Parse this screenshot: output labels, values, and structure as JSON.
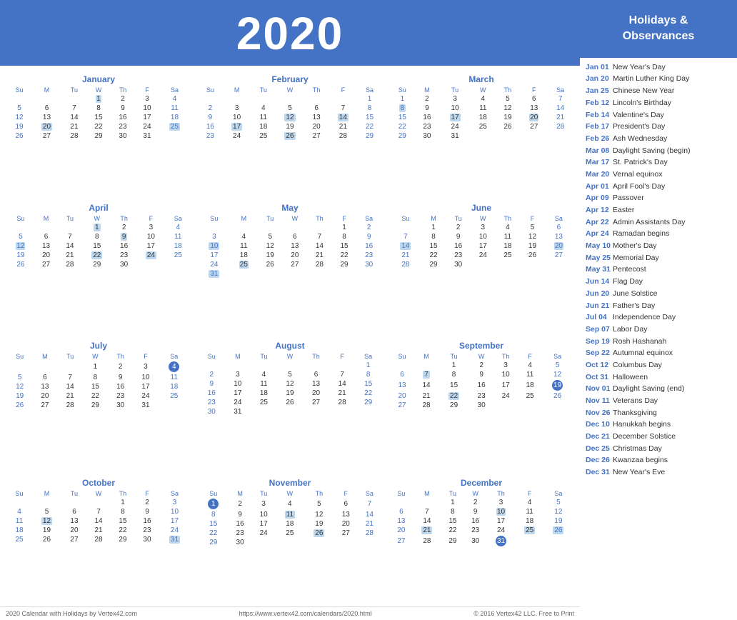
{
  "title": "2020",
  "header": {
    "holidays_title": "Holidays &\nObservances"
  },
  "months": [
    {
      "name": "January",
      "days": [
        [
          "",
          "",
          "",
          "1",
          "2",
          "3",
          "4"
        ],
        [
          "5",
          "6",
          "7",
          "8",
          "9",
          "10",
          "11"
        ],
        [
          "12",
          "13",
          "14",
          "15",
          "16",
          "17",
          "18"
        ],
        [
          "19",
          "20",
          "21",
          "22",
          "23",
          "24",
          "25"
        ],
        [
          "26",
          "27",
          "28",
          "29",
          "30",
          "31",
          ""
        ]
      ],
      "highlights": {
        "1": "holiday",
        "20": "highlight",
        "25": "highlight"
      }
    },
    {
      "name": "February",
      "days": [
        [
          "",
          "",
          "",
          "",
          "",
          "",
          "1"
        ],
        [
          "2",
          "3",
          "4",
          "5",
          "6",
          "7",
          "8"
        ],
        [
          "9",
          "10",
          "11",
          "12",
          "13",
          "14",
          "15"
        ],
        [
          "16",
          "17",
          "18",
          "19",
          "20",
          "21",
          "22"
        ],
        [
          "23",
          "24",
          "25",
          "26",
          "27",
          "28",
          "29"
        ]
      ],
      "highlights": {
        "12": "highlight",
        "14": "highlight",
        "17": "highlight",
        "26": "highlight"
      }
    },
    {
      "name": "March",
      "days": [
        [
          "1",
          "2",
          "3",
          "4",
          "5",
          "6",
          "7"
        ],
        [
          "8",
          "9",
          "10",
          "11",
          "12",
          "13",
          "14"
        ],
        [
          "15",
          "16",
          "17",
          "18",
          "19",
          "20",
          "21"
        ],
        [
          "22",
          "23",
          "24",
          "25",
          "26",
          "27",
          "28"
        ],
        [
          "29",
          "30",
          "31",
          "",
          "",
          "",
          ""
        ]
      ],
      "highlights": {
        "8": "highlight",
        "17": "highlight",
        "20": "holiday"
      }
    },
    {
      "name": "April",
      "days": [
        [
          "",
          "",
          "",
          "1",
          "2",
          "3",
          "4"
        ],
        [
          "5",
          "6",
          "7",
          "8",
          "9",
          "10",
          "11"
        ],
        [
          "12",
          "13",
          "14",
          "15",
          "16",
          "17",
          "18"
        ],
        [
          "19",
          "20",
          "21",
          "22",
          "23",
          "24",
          "25"
        ],
        [
          "26",
          "27",
          "28",
          "29",
          "30",
          "",
          ""
        ]
      ],
      "highlights": {
        "1": "highlight",
        "9": "highlight",
        "12": "holiday",
        "22": "highlight",
        "24": "highlight"
      }
    },
    {
      "name": "May",
      "days": [
        [
          "",
          "",
          "",
          "",
          "",
          "1",
          "2"
        ],
        [
          "3",
          "4",
          "5",
          "6",
          "7",
          "8",
          "9"
        ],
        [
          "10",
          "11",
          "12",
          "13",
          "14",
          "15",
          "16"
        ],
        [
          "17",
          "18",
          "19",
          "20",
          "21",
          "22",
          "23"
        ],
        [
          "24",
          "25",
          "26",
          "27",
          "28",
          "29",
          "30"
        ],
        [
          "31",
          "",
          "",
          "",
          "",
          "",
          ""
        ]
      ],
      "highlights": {
        "10": "highlight",
        "25": "holiday",
        "31": "highlight"
      }
    },
    {
      "name": "June",
      "days": [
        [
          "",
          "1",
          "2",
          "3",
          "4",
          "5",
          "6"
        ],
        [
          "7",
          "8",
          "9",
          "10",
          "11",
          "12",
          "13"
        ],
        [
          "14",
          "15",
          "16",
          "17",
          "18",
          "19",
          "20"
        ],
        [
          "21",
          "22",
          "23",
          "24",
          "25",
          "26",
          "27"
        ],
        [
          "28",
          "29",
          "30",
          "",
          "",
          "",
          ""
        ]
      ],
      "highlights": {
        "14": "highlight",
        "20": "holiday",
        "6": "saturday"
      }
    },
    {
      "name": "July",
      "days": [
        [
          "",
          "",
          "",
          "1",
          "2",
          "3",
          "4"
        ],
        [
          "5",
          "6",
          "7",
          "8",
          "9",
          "10",
          "11"
        ],
        [
          "12",
          "13",
          "14",
          "15",
          "16",
          "17",
          "18"
        ],
        [
          "19",
          "20",
          "21",
          "22",
          "23",
          "24",
          "25"
        ],
        [
          "26",
          "27",
          "28",
          "29",
          "30",
          "31",
          ""
        ]
      ],
      "highlights": {
        "4": "circle"
      }
    },
    {
      "name": "August",
      "days": [
        [
          "",
          "",
          "",
          "",
          "",
          "",
          "1"
        ],
        [
          "2",
          "3",
          "4",
          "5",
          "6",
          "7",
          "8"
        ],
        [
          "9",
          "10",
          "11",
          "12",
          "13",
          "14",
          "15"
        ],
        [
          "16",
          "17",
          "18",
          "19",
          "20",
          "21",
          "22"
        ],
        [
          "23",
          "24",
          "25",
          "26",
          "27",
          "28",
          "29"
        ],
        [
          "30",
          "31",
          "",
          "",
          "",
          "",
          ""
        ]
      ],
      "highlights": {}
    },
    {
      "name": "September",
      "days": [
        [
          "",
          "",
          "1",
          "2",
          "3",
          "4",
          "5"
        ],
        [
          "6",
          "7",
          "8",
          "9",
          "10",
          "11",
          "12"
        ],
        [
          "13",
          "14",
          "15",
          "16",
          "17",
          "18",
          "19"
        ],
        [
          "20",
          "21",
          "22",
          "23",
          "24",
          "25",
          "26"
        ],
        [
          "27",
          "28",
          "29",
          "30",
          "",
          "",
          ""
        ]
      ],
      "highlights": {
        "7": "highlight",
        "19": "circle",
        "22": "highlight"
      }
    },
    {
      "name": "October",
      "days": [
        [
          "",
          "",
          "",
          "",
          "1",
          "2",
          "3"
        ],
        [
          "4",
          "5",
          "6",
          "7",
          "8",
          "9",
          "10"
        ],
        [
          "11",
          "12",
          "13",
          "14",
          "15",
          "16",
          "17"
        ],
        [
          "18",
          "19",
          "20",
          "21",
          "22",
          "23",
          "24"
        ],
        [
          "25",
          "26",
          "27",
          "28",
          "29",
          "30",
          "31"
        ]
      ],
      "highlights": {
        "12": "highlight",
        "31": "highlight",
        "3": "saturday",
        "17": "saturday"
      }
    },
    {
      "name": "November",
      "days": [
        [
          "1",
          "2",
          "3",
          "4",
          "5",
          "6",
          "7"
        ],
        [
          "8",
          "9",
          "10",
          "11",
          "12",
          "13",
          "14"
        ],
        [
          "15",
          "16",
          "17",
          "18",
          "19",
          "20",
          "21"
        ],
        [
          "22",
          "23",
          "24",
          "25",
          "26",
          "27",
          "28"
        ],
        [
          "29",
          "30",
          "",
          "",
          "",
          "",
          ""
        ]
      ],
      "highlights": {
        "1": "circle",
        "11": "highlight",
        "26": "highlight"
      }
    },
    {
      "name": "December",
      "days": [
        [
          "",
          "",
          "1",
          "2",
          "3",
          "4",
          "5"
        ],
        [
          "6",
          "7",
          "8",
          "9",
          "10",
          "11",
          "12"
        ],
        [
          "13",
          "14",
          "15",
          "16",
          "17",
          "18",
          "19"
        ],
        [
          "20",
          "21",
          "22",
          "23",
          "24",
          "25",
          "26"
        ],
        [
          "27",
          "28",
          "29",
          "30",
          "31",
          "",
          ""
        ]
      ],
      "highlights": {
        "10": "holiday",
        "21": "highlight",
        "25": "highlight",
        "26": "highlight",
        "31": "circle"
      }
    }
  ],
  "holidays": [
    {
      "date": "Jan 01",
      "name": "New Year's Day"
    },
    {
      "date": "Jan 20",
      "name": "Martin Luther King Day"
    },
    {
      "date": "Jan 25",
      "name": "Chinese New Year"
    },
    {
      "date": "Feb 12",
      "name": "Lincoln's Birthday"
    },
    {
      "date": "Feb 14",
      "name": "Valentine's Day"
    },
    {
      "date": "Feb 17",
      "name": "President's Day"
    },
    {
      "date": "Feb 26",
      "name": "Ash Wednesday"
    },
    {
      "date": "Mar 08",
      "name": "Daylight Saving (begin)"
    },
    {
      "date": "Mar 17",
      "name": "St. Patrick's Day"
    },
    {
      "date": "Mar 20",
      "name": "Vernal equinox"
    },
    {
      "date": "Apr 01",
      "name": "April Fool's Day"
    },
    {
      "date": "Apr 09",
      "name": "Passover"
    },
    {
      "date": "Apr 12",
      "name": "Easter"
    },
    {
      "date": "Apr 22",
      "name": "Admin Assistants Day"
    },
    {
      "date": "Apr 24",
      "name": "Ramadan begins"
    },
    {
      "date": "May 10",
      "name": "Mother's Day"
    },
    {
      "date": "May 25",
      "name": "Memorial Day"
    },
    {
      "date": "May 31",
      "name": "Pentecost"
    },
    {
      "date": "Jun 14",
      "name": "Flag Day"
    },
    {
      "date": "Jun 20",
      "name": "June Solstice"
    },
    {
      "date": "Jun 21",
      "name": "Father's Day"
    },
    {
      "date": "Jul 04",
      "name": "Independence Day"
    },
    {
      "date": "Sep 07",
      "name": "Labor Day"
    },
    {
      "date": "Sep 19",
      "name": "Rosh Hashanah"
    },
    {
      "date": "Sep 22",
      "name": "Autumnal equinox"
    },
    {
      "date": "Oct 12",
      "name": "Columbus Day"
    },
    {
      "date": "Oct 31",
      "name": "Halloween"
    },
    {
      "date": "Nov 01",
      "name": "Daylight Saving (end)"
    },
    {
      "date": "Nov 11",
      "name": "Veterans Day"
    },
    {
      "date": "Nov 26",
      "name": "Thanksgiving"
    },
    {
      "date": "Dec 10",
      "name": "Hanukkah begins"
    },
    {
      "date": "Dec 21",
      "name": "December Solstice"
    },
    {
      "date": "Dec 25",
      "name": "Christmas Day"
    },
    {
      "date": "Dec 26",
      "name": "Kwanzaa begins"
    },
    {
      "date": "Dec 31",
      "name": "New Year's Eve"
    }
  ],
  "footer": {
    "left": "2020 Calendar with Holidays by Vertex42.com",
    "center": "https://www.vertex42.com/calendars/2020.html",
    "right": "© 2016 Vertex42 LLC. Free to Print"
  }
}
